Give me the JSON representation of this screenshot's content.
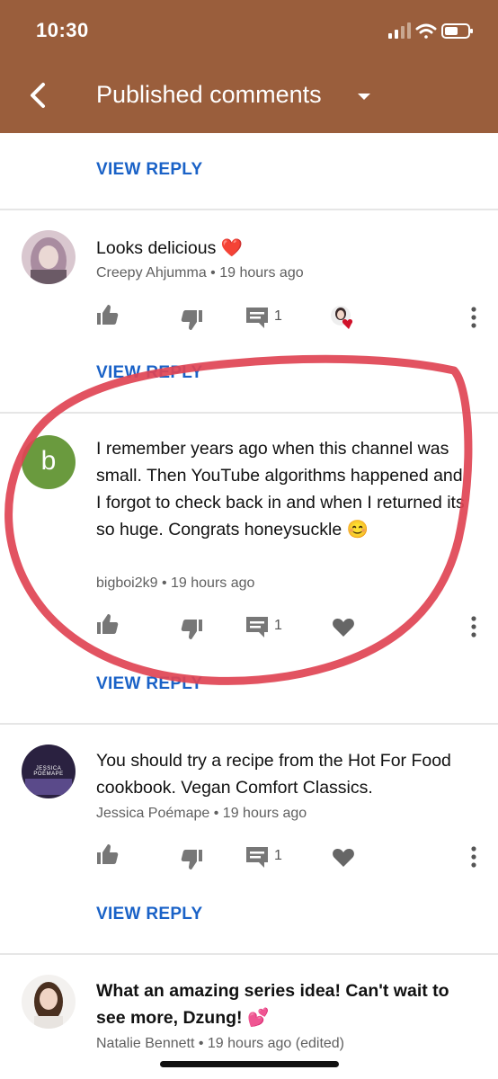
{
  "status": {
    "time": "10:30"
  },
  "header": {
    "title": "Published comments"
  },
  "view_reply_label": "VIEW REPLY",
  "comments": [
    {
      "text": "Looks delicious ❤️",
      "author": "Creepy Ahjumma",
      "time": "19 hours ago",
      "reply_count": "1"
    },
    {
      "avatar_letter": "b",
      "text": "I remember years ago when this channel was small. Then YouTube algorithms happened and I forgot to check back in and when I returned its so huge. Congrats honeysuckle 😊",
      "author": "bigboi2k9",
      "time": "19 hours ago",
      "reply_count": "1"
    },
    {
      "avatar_text": "JESSICA POÉMAPE",
      "text": "You should try a recipe from the Hot For Food cookbook. Vegan Comfort Classics.",
      "author": "Jessica Poémape",
      "time": "19 hours ago",
      "reply_count": "1"
    },
    {
      "text": "What an amazing series idea! Can't wait to see more, Dzung! 💕",
      "author": "Natalie Bennett",
      "time": "19 hours ago (edited)"
    }
  ],
  "colors": {
    "header": "#9a5e3c",
    "link": "#1a62c7",
    "annotation": "#e04454",
    "avatar_b": "#6a9a3e"
  }
}
